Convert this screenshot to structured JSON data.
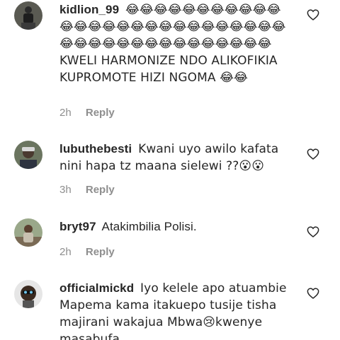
{
  "comments": [
    {
      "username": "kidlion_99",
      "text": "😂😂😂😂😂😂😂😂😂😂😂😂😂😂😂😂😂😂😂😂😂😂😂😂😂😂😂😂😂😂😂😂😂😂😂😂😂😂😂😂😂😂KWELI HARMONIZE NDO ALIKOFIKIA KUPROMOTE HIZI NGOMA 😂😂",
      "time": "2h",
      "reply_label": "Reply",
      "avatar_icon": "avatar-dark-figure"
    },
    {
      "username": "lubuthebesti",
      "text": "Kwani uyo awilo kafata nini hapa tz maana sielewi ??😮😮",
      "time": "3h",
      "reply_label": "Reply",
      "avatar_icon": "avatar-man-cap"
    },
    {
      "username": "bryt97",
      "text": "Atakimbilia Polisi.",
      "time": "2h",
      "reply_label": "Reply",
      "avatar_icon": "avatar-person-outdoor"
    },
    {
      "username": "officialmickd",
      "text": "Iyo kelele apo atuambie Mapema kama itakuepo tusije tisha majirani wakajua Mbwa😢kwenye masabufa",
      "time": "",
      "reply_label": "",
      "avatar_icon": "avatar-cartoon"
    }
  ],
  "colors": {
    "text": "#262626",
    "meta": "#8e8e8e",
    "background": "#ffffff"
  }
}
